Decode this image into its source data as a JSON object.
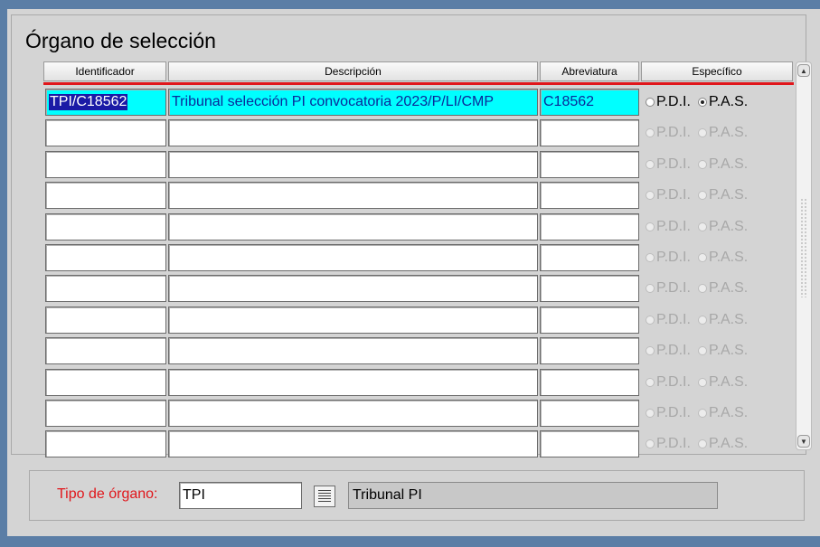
{
  "block": {
    "title": "Órgano de selección"
  },
  "columns": {
    "identificador": "Identificador",
    "descripcion": "Descripción",
    "abreviatura": "Abreviatura",
    "especifico": "Específico"
  },
  "radio_labels": {
    "pdi": "P.D.I.",
    "pas": "P.A.S."
  },
  "rows": [
    {
      "identificador": "TPI/C18562",
      "descripcion": "Tribunal selección PI convocatoria 2023/P/LI/CMP",
      "abreviatura": "C18562",
      "especifico": "P.A.S."
    },
    {
      "identificador": "",
      "descripcion": "",
      "abreviatura": "",
      "especifico": ""
    },
    {
      "identificador": "",
      "descripcion": "",
      "abreviatura": "",
      "especifico": ""
    },
    {
      "identificador": "",
      "descripcion": "",
      "abreviatura": "",
      "especifico": ""
    },
    {
      "identificador": "",
      "descripcion": "",
      "abreviatura": "",
      "especifico": ""
    },
    {
      "identificador": "",
      "descripcion": "",
      "abreviatura": "",
      "especifico": ""
    },
    {
      "identificador": "",
      "descripcion": "",
      "abreviatura": "",
      "especifico": ""
    },
    {
      "identificador": "",
      "descripcion": "",
      "abreviatura": "",
      "especifico": ""
    },
    {
      "identificador": "",
      "descripcion": "",
      "abreviatura": "",
      "especifico": ""
    },
    {
      "identificador": "",
      "descripcion": "",
      "abreviatura": "",
      "especifico": ""
    },
    {
      "identificador": "",
      "descripcion": "",
      "abreviatura": "",
      "especifico": ""
    },
    {
      "identificador": "",
      "descripcion": "",
      "abreviatura": "",
      "especifico": ""
    }
  ],
  "tipo_organo": {
    "label": "Tipo de órgano:",
    "value": "TPI",
    "description": "Tribunal PI"
  },
  "colors": {
    "active_row": "#00ffff",
    "header_underline": "#e0161b",
    "label_required": "#e0161b",
    "window_bg": "#5b7ea6"
  },
  "icons": {
    "lov_button": "list-icon",
    "scroll_up": "arrow-up-icon",
    "scroll_down": "arrow-down-icon"
  }
}
